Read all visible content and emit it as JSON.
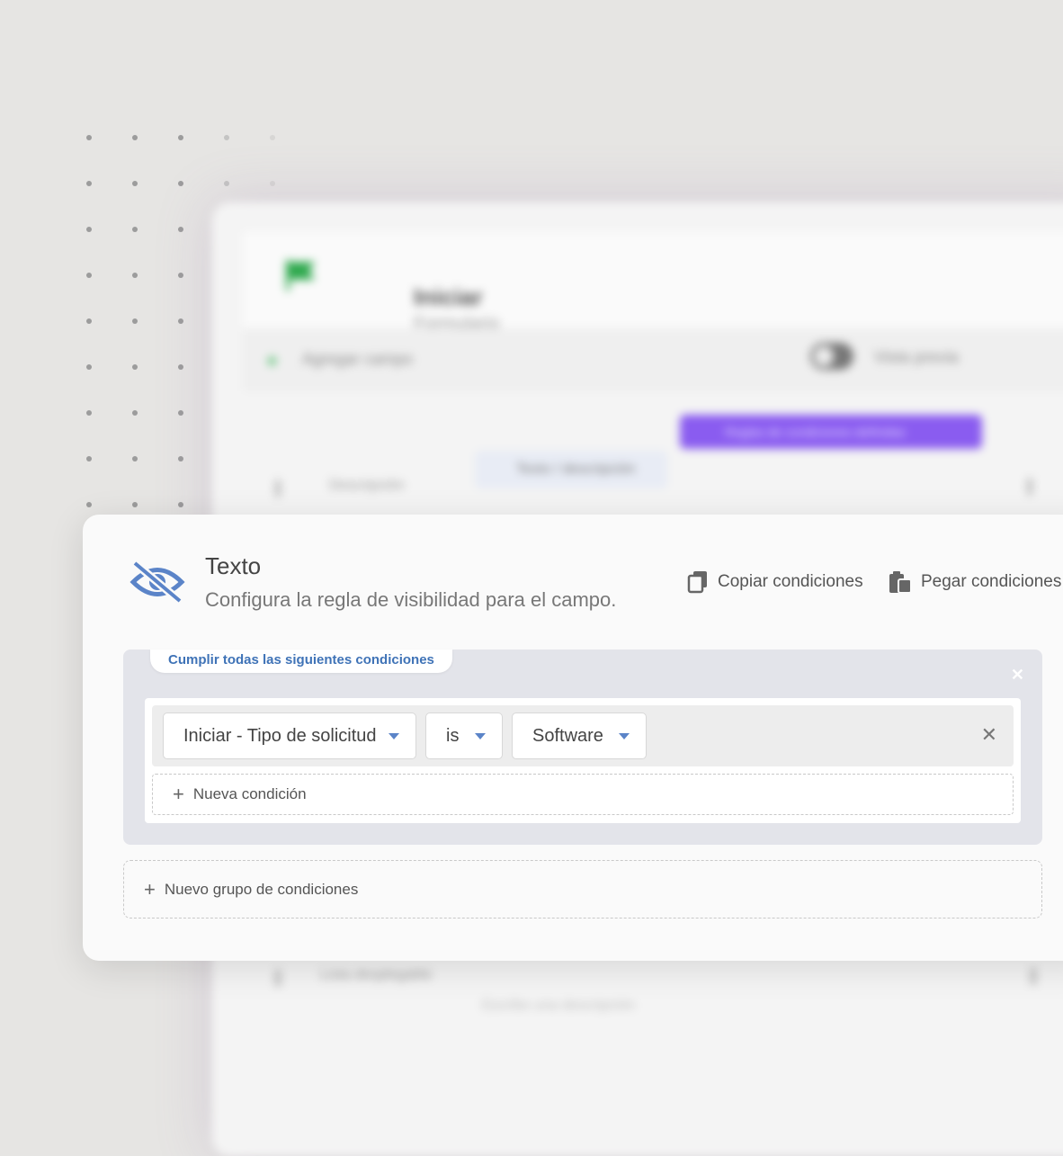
{
  "background": {
    "title": "Iniciar",
    "subtitle": "Formulario",
    "add_field": "Agregar campo",
    "preview_label": "Vista previa",
    "rule_button": "Reglas de condiciones definidas",
    "field_chip": "Texto / descripción",
    "description_label": "Descripción",
    "second_row_label": "Lista desplegable",
    "second_row_hint": "Escribe una descripción"
  },
  "modal": {
    "title": "Texto",
    "subtitle": "Configura la regla de visibilidad para el campo.",
    "copy_label": "Copiar condiciones",
    "paste_label": "Pegar condiciones",
    "group_label": "Cumplir todas las siguientes condiciones",
    "condition": {
      "field": "Iniciar - Tipo de solicitud",
      "operator": "is",
      "value": "Software"
    },
    "new_condition_label": "Nueva condición",
    "new_group_label": "Nuevo grupo de condiciones"
  },
  "colors": {
    "accent_blue": "#5b84c8",
    "link_blue": "#3f73b7",
    "purple": "#8a5cf0",
    "green": "#29b24b"
  }
}
